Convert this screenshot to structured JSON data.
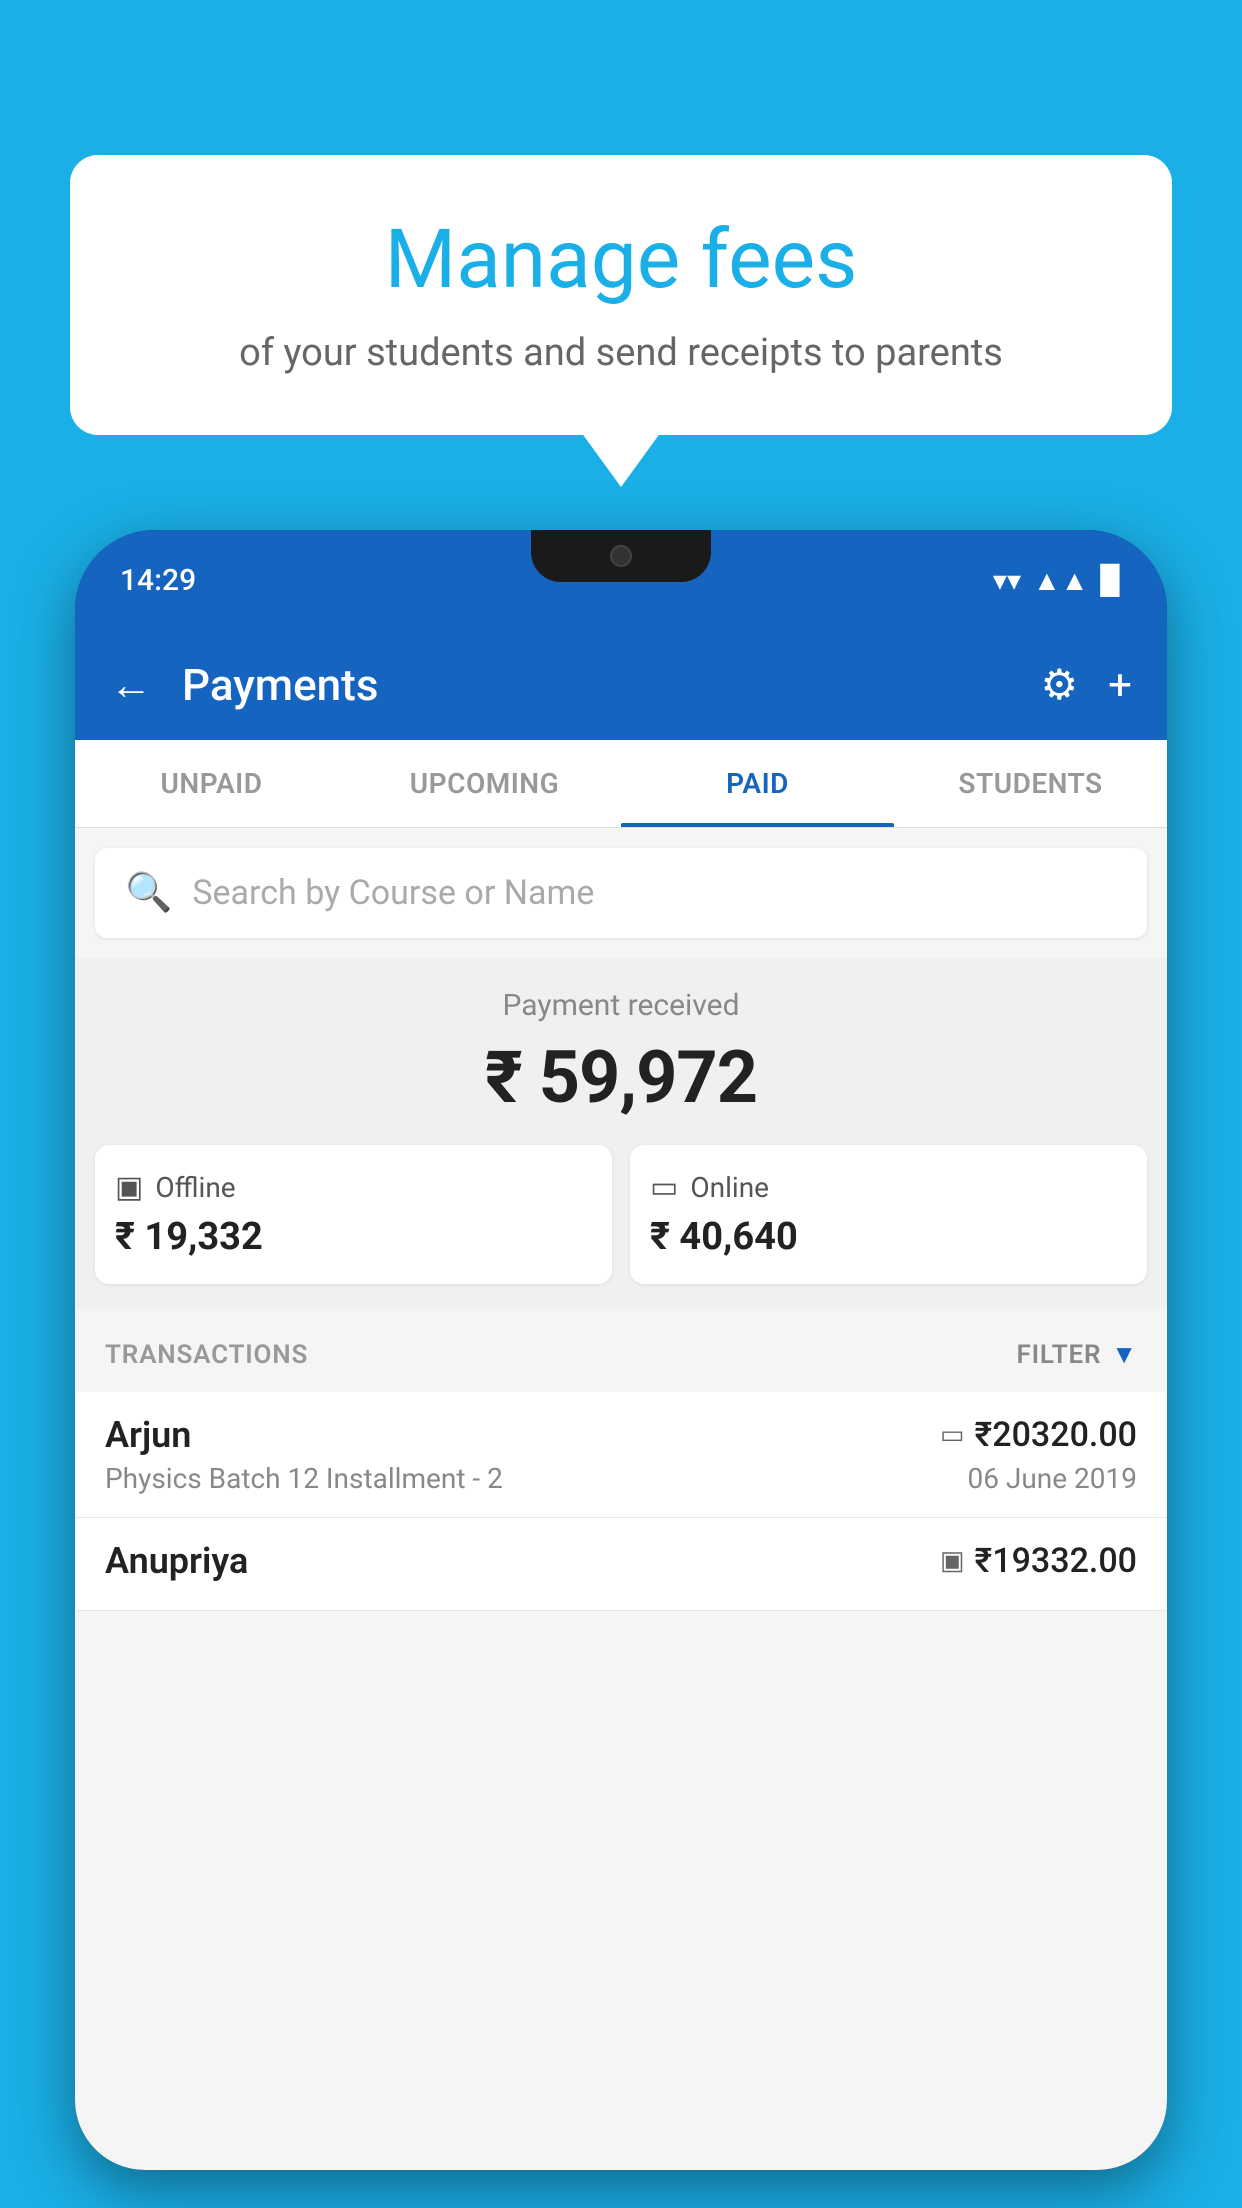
{
  "bubble": {
    "title": "Manage fees",
    "subtitle": "of your students and send receipts to parents"
  },
  "status_bar": {
    "time": "14:29",
    "wifi": "▲",
    "signal": "▲",
    "battery": "▉"
  },
  "header": {
    "title": "Payments",
    "back_label": "←",
    "plus_label": "+"
  },
  "tabs": [
    {
      "label": "UNPAID",
      "active": false
    },
    {
      "label": "UPCOMING",
      "active": false
    },
    {
      "label": "PAID",
      "active": true
    },
    {
      "label": "STUDENTS",
      "active": false
    }
  ],
  "search": {
    "placeholder": "Search by Course or Name"
  },
  "payment_summary": {
    "label": "Payment received",
    "total": "₹ 59,972",
    "offline_label": "Offline",
    "offline_amount": "₹ 19,332",
    "online_label": "Online",
    "online_amount": "₹ 40,640"
  },
  "transactions": {
    "header_label": "TRANSACTIONS",
    "filter_label": "FILTER",
    "items": [
      {
        "name": "Arjun",
        "course": "Physics Batch 12 Installment - 2",
        "amount": "₹20320.00",
        "date": "06 June 2019",
        "method": "online"
      },
      {
        "name": "Anupriya",
        "course": "",
        "amount": "₹19332.00",
        "date": "",
        "method": "offline"
      }
    ]
  },
  "icons": {
    "back": "←",
    "gear": "⚙",
    "plus": "+",
    "search": "🔍",
    "filter": "▼",
    "card": "▭",
    "offline_card": "▣"
  }
}
